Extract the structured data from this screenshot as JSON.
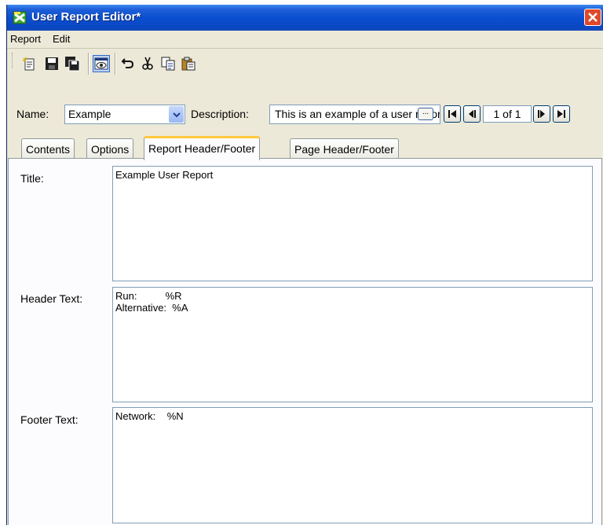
{
  "window": {
    "title": "User Report Editor*"
  },
  "menu": [
    "Report",
    "Edit"
  ],
  "toolbar": {
    "icons": [
      "new-report-icon",
      "save-icon",
      "save-all-icon",
      "preview-icon",
      "undo-icon",
      "cut-icon",
      "copy-icon",
      "paste-icon"
    ]
  },
  "form": {
    "name_label": "Name:",
    "name_value": "Example",
    "description_label": "Description:",
    "description_value": "This is an example of a user report",
    "ellipsis": "...",
    "page_counter": "1 of 1"
  },
  "tabs": [
    "Contents",
    "Options",
    "Report Header/Footer",
    "Page Header/Footer"
  ],
  "active_tab": "Report Header/Footer",
  "fields": {
    "title": {
      "label": "Title:",
      "value": "Example User Report"
    },
    "header": {
      "label": "Header Text:",
      "value": "Run:          %R\nAlternative:  %A"
    },
    "footer": {
      "label": "Footer Text:",
      "value": "Network:    %N"
    }
  },
  "colors": {
    "titlebar": "#0a4fd0",
    "window_bg": "#ece9d8",
    "tab_highlight": "#ffc83c",
    "field_border": "#7f9db9"
  }
}
